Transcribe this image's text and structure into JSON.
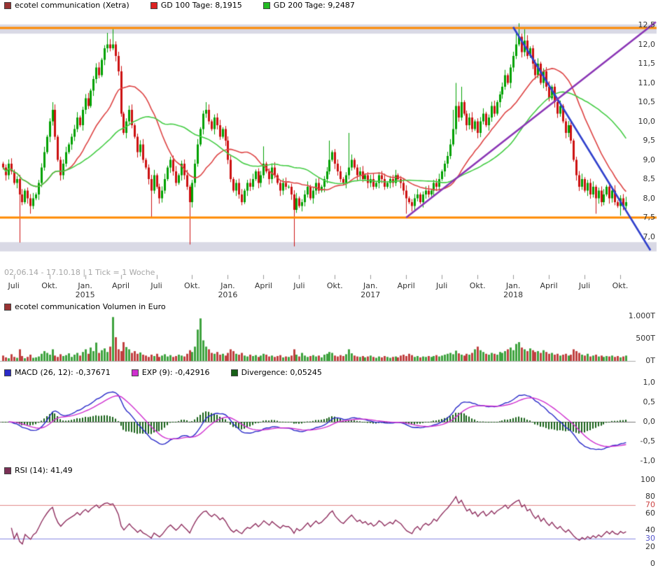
{
  "main_chart": {
    "legend": [
      {
        "color": "#993333",
        "label": "ecotel communication (Xetra)"
      },
      {
        "color": "#dd2222",
        "label": "GD 100 Tage: 8,1915"
      },
      {
        "color": "#22bb22",
        "label": "GD 200 Tage: 9,2487"
      }
    ],
    "date_note": "02.06.14 - 17.10.18 | 1 Tick = 1 Woche",
    "y_ticks": [
      {
        "label": "12,5",
        "value": 12.5
      },
      {
        "label": "12,0",
        "value": 12.0
      },
      {
        "label": "11,5",
        "value": 11.5
      },
      {
        "label": "11,0",
        "value": 11.0
      },
      {
        "label": "10,5",
        "value": 10.5
      },
      {
        "label": "10,0",
        "value": 10.0
      },
      {
        "label": "9,5",
        "value": 9.5
      },
      {
        "label": "9,0",
        "value": 9.0
      },
      {
        "label": "8,5",
        "value": 8.5
      },
      {
        "label": "8,0",
        "value": 8.0
      },
      {
        "label": "7,5",
        "value": 7.5
      },
      {
        "label": "7,0",
        "value": 7.0
      }
    ],
    "x_ticks": [
      {
        "week": 4,
        "label": "Juli"
      },
      {
        "week": 17,
        "label": "Okt."
      },
      {
        "week": 30,
        "label": "Jan.",
        "year": "2015"
      },
      {
        "week": 43,
        "label": "April"
      },
      {
        "week": 56,
        "label": "Juli"
      },
      {
        "week": 69,
        "label": "Okt."
      },
      {
        "week": 82,
        "label": "Jan.",
        "year": "2016"
      },
      {
        "week": 95,
        "label": "April"
      },
      {
        "week": 108,
        "label": "Juli"
      },
      {
        "week": 121,
        "label": "Okt."
      },
      {
        "week": 134,
        "label": "Jan.",
        "year": "2017"
      },
      {
        "week": 147,
        "label": "April"
      },
      {
        "week": 160,
        "label": "Juli"
      },
      {
        "week": 173,
        "label": "Okt."
      },
      {
        "week": 186,
        "label": "Jan.",
        "year": "2018"
      },
      {
        "week": 199,
        "label": "April"
      },
      {
        "week": 212,
        "label": "Juli"
      },
      {
        "week": 225,
        "label": "Okt."
      }
    ]
  },
  "volume_chart": {
    "legend": [
      {
        "color": "#993333",
        "label": "ecotel communication Volumen in Euro"
      }
    ],
    "y_ticks": [
      {
        "label": "1.000T",
        "value": 1000
      },
      {
        "label": "500T",
        "value": 500
      },
      {
        "label": "0T",
        "value": 0
      }
    ]
  },
  "macd_chart": {
    "legend": [
      {
        "color": "#2a2ac8",
        "label": "MACD (26, 12): -0,37671"
      },
      {
        "color": "#cf2fcf",
        "label": "EXP (9): -0,42916"
      },
      {
        "color": "#176017",
        "label": "Divergence: 0,05245"
      }
    ],
    "y_ticks": [
      {
        "label": "1,0",
        "value": 1.0
      },
      {
        "label": "0,5",
        "value": 0.5
      },
      {
        "label": "0,0",
        "value": 0.0
      },
      {
        "label": "-0,5",
        "value": -0.5
      },
      {
        "label": "-1,0",
        "value": -1.0
      }
    ]
  },
  "rsi_chart": {
    "legend": [
      {
        "color": "#7a2f55",
        "label": "RSI (14): 41,49"
      }
    ],
    "y_ticks": [
      {
        "label": "100",
        "value": 100
      },
      {
        "label": "80",
        "value": 80
      },
      {
        "label": "70",
        "value": 70,
        "color": "#cc4444"
      },
      {
        "label": "60",
        "value": 60
      },
      {
        "label": "40",
        "value": 40
      },
      {
        "label": "30",
        "value": 30,
        "color": "#5555cc"
      },
      {
        "label": "20",
        "value": 20
      },
      {
        "label": "0",
        "value": 0
      }
    ]
  },
  "chart_data": {
    "type": "candlestick",
    "instrument": "ecotel communication (Xetra)",
    "tick_interval": "1 Woche",
    "date_range": "02.06.14 - 17.10.18",
    "y_range": [
      7.0,
      12.5
    ],
    "gd100_last": 8.1915,
    "gd200_last": 9.2487,
    "macd_last": -0.37671,
    "macd_signal_last": -0.42916,
    "macd_divergence_last": 0.05245,
    "rsi_last": 41.49,
    "closes": [
      8.8,
      8.6,
      8.9,
      8.7,
      8.4,
      8.5,
      8.1,
      7.9,
      8.2,
      8.0,
      7.8,
      8.0,
      8.1,
      8.4,
      8.8,
      9.2,
      9.6,
      10.0,
      10.3,
      9.6,
      9.0,
      8.6,
      8.9,
      9.2,
      9.4,
      9.6,
      9.8,
      10.1,
      9.9,
      10.3,
      10.6,
      10.4,
      10.8,
      11.1,
      11.4,
      11.2,
      11.6,
      11.9,
      12.0,
      11.9,
      12.0,
      11.7,
      11.3,
      10.2,
      9.7,
      10.0,
      10.3,
      9.9,
      9.6,
      9.2,
      9.4,
      9.0,
      8.8,
      8.5,
      8.2,
      8.6,
      8.3,
      8.0,
      8.2,
      8.5,
      8.8,
      9.0,
      8.7,
      8.4,
      8.6,
      8.9,
      8.6,
      8.3,
      7.9,
      8.4,
      8.9,
      9.4,
      9.8,
      10.2,
      10.3,
      10.0,
      9.8,
      10.1,
      9.9,
      9.6,
      9.8,
      9.5,
      9.0,
      8.5,
      8.2,
      8.4,
      8.1,
      7.9,
      8.2,
      8.4,
      8.3,
      8.5,
      8.7,
      8.4,
      8.6,
      8.9,
      8.7,
      8.5,
      8.8,
      8.6,
      8.4,
      8.2,
      8.4,
      8.3,
      8.3,
      8.1,
      7.7,
      8.0,
      7.8,
      7.9,
      8.1,
      8.3,
      8.0,
      8.2,
      8.4,
      8.2,
      8.3,
      8.5,
      8.7,
      9.0,
      9.2,
      8.9,
      8.7,
      8.5,
      8.4,
      8.6,
      8.8,
      9.0,
      8.8,
      8.6,
      8.7,
      8.5,
      8.6,
      8.4,
      8.5,
      8.3,
      8.4,
      8.6,
      8.5,
      8.3,
      8.4,
      8.5,
      8.4,
      8.6,
      8.5,
      8.4,
      8.2,
      8.0,
      7.9,
      7.8,
      8.0,
      8.1,
      7.9,
      8.1,
      8.2,
      8.1,
      8.2,
      8.4,
      8.3,
      8.5,
      8.7,
      8.9,
      9.1,
      9.4,
      9.8,
      10.4,
      10.1,
      10.5,
      10.2,
      9.9,
      10.1,
      9.8,
      10.0,
      9.7,
      10.0,
      10.2,
      9.9,
      10.1,
      10.4,
      10.2,
      10.5,
      10.7,
      10.9,
      11.2,
      11.0,
      11.4,
      11.7,
      12.0,
      12.2,
      11.8,
      12.1,
      11.7,
      11.9,
      11.5,
      11.2,
      11.5,
      11.0,
      11.3,
      10.9,
      10.6,
      10.9,
      10.5,
      10.2,
      10.4,
      10.0,
      9.7,
      9.9,
      9.5,
      9.0,
      8.6,
      8.3,
      8.5,
      8.2,
      8.4,
      8.1,
      8.3,
      8.0,
      8.2,
      7.9,
      8.1,
      8.3,
      8.0,
      8.2,
      7.9,
      7.8,
      8.0,
      7.8,
      7.9
    ],
    "wick_highs": {
      "18": 10.5,
      "38": 12.3,
      "40": 12.4,
      "74": 10.5,
      "95": 9.35,
      "119": 9.5,
      "126": 9.7,
      "164": 10.3,
      "165": 11.0,
      "167": 10.9,
      "187": 12.3,
      "188": 12.55,
      "190": 12.4
    },
    "wick_lows": {
      "6": 6.85,
      "10": 7.6,
      "54": 7.5,
      "68": 6.8,
      "106": 6.75,
      "147": 7.6,
      "216": 7.6,
      "225": 7.55
    },
    "volumes_T": [
      120,
      80,
      60,
      150,
      90,
      70,
      260,
      110,
      60,
      90,
      140,
      70,
      80,
      100,
      160,
      220,
      180,
      140,
      260,
      120,
      90,
      150,
      110,
      130,
      170,
      90,
      140,
      180,
      120,
      200,
      260,
      160,
      300,
      220,
      410,
      180,
      240,
      280,
      200,
      320,
      980,
      530,
      260,
      220,
      420,
      310,
      260,
      180,
      220,
      160,
      190,
      140,
      120,
      90,
      140,
      110,
      160,
      90,
      120,
      150,
      100,
      130,
      90,
      110,
      140,
      120,
      100,
      160,
      240,
      200,
      320,
      700,
      950,
      460,
      320,
      260,
      180,
      160,
      200,
      140,
      160,
      120,
      180,
      260,
      220,
      160,
      140,
      180,
      120,
      100,
      140,
      110,
      130,
      90,
      120,
      160,
      140,
      100,
      120,
      90,
      110,
      130,
      80,
      100,
      90,
      120,
      260,
      140,
      100,
      180,
      120,
      90,
      110,
      130,
      100,
      120,
      80,
      140,
      160,
      200,
      180,
      120,
      100,
      130,
      110,
      150,
      260,
      170,
      120,
      100,
      90,
      110,
      80,
      100,
      120,
      90,
      70,
      100,
      80,
      110,
      90,
      70,
      90,
      100,
      80,
      120,
      140,
      110,
      160,
      130,
      90,
      110,
      80,
      100,
      90,
      110,
      90,
      110,
      130,
      100,
      120,
      140,
      160,
      180,
      150,
      230,
      170,
      140,
      120,
      160,
      140,
      180,
      260,
      320,
      240,
      200,
      160,
      140,
      180,
      160,
      140,
      200,
      180,
      220,
      260,
      300,
      240,
      380,
      420,
      300,
      260,
      220,
      280,
      240,
      200,
      220,
      180,
      240,
      200,
      160,
      180,
      140,
      160,
      120,
      140,
      160,
      120,
      140,
      260,
      220,
      180,
      140,
      120,
      160,
      100,
      120,
      140,
      100,
      120,
      90,
      110,
      100,
      120,
      90,
      110,
      80,
      100,
      120
    ],
    "hlines": [
      {
        "value": 12.42,
        "color": "#ff8a00"
      },
      {
        "value": 7.5,
        "color": "#ff8a00"
      }
    ],
    "trendlines": [
      {
        "from_week": 186,
        "from_price": 12.45,
        "to_week": 236,
        "to_price": 6.65,
        "color": "#3040cc"
      },
      {
        "from_week": 147,
        "from_price": 7.5,
        "to_week": 238,
        "to_price": 12.58,
        "color": "#8a35b5"
      }
    ],
    "bands": [
      {
        "from": 12.28,
        "to": 12.52
      },
      {
        "from": 6.62,
        "to": 6.86
      }
    ],
    "colors": {
      "up": "#00a000",
      "down": "#cc1010",
      "gd100": "#dd4444",
      "gd200": "#44cc44",
      "vol_up": "#3fa33f",
      "vol_down": "#c04040",
      "macd": "#2a2ac8",
      "macd_signal": "#cf2fcf",
      "macd_hist": "#176017",
      "rsi": "#8f2f5f",
      "band": "#d9d9e5"
    }
  }
}
